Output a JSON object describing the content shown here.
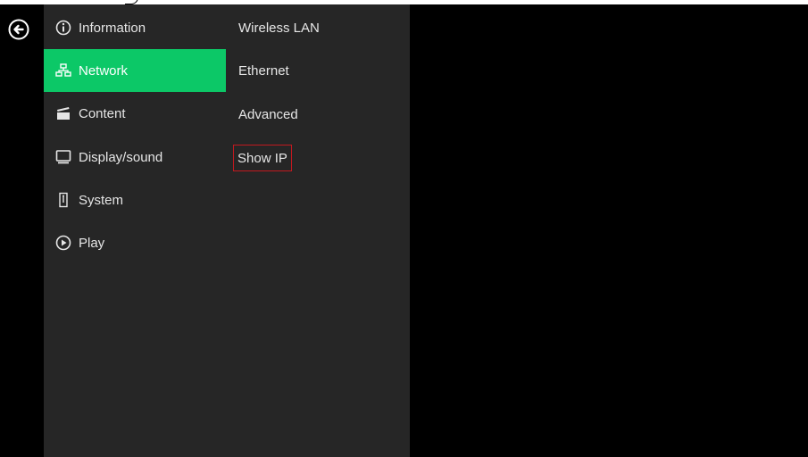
{
  "menu": {
    "items": [
      {
        "label": "Information",
        "icon": "info-icon"
      },
      {
        "label": "Network",
        "icon": "network-icon",
        "active": true
      },
      {
        "label": "Content",
        "icon": "clapperboard-icon"
      },
      {
        "label": "Display/sound",
        "icon": "monitor-icon"
      },
      {
        "label": "System",
        "icon": "system-icon"
      },
      {
        "label": "Play",
        "icon": "play-icon"
      }
    ]
  },
  "submenu": {
    "items": [
      {
        "label": "Wireless LAN"
      },
      {
        "label": "Ethernet"
      },
      {
        "label": "Advanced"
      },
      {
        "label": "Show IP",
        "highlighted": true
      }
    ]
  },
  "colors": {
    "active": "#0cc867",
    "panel": "#262626",
    "highlight_border": "#c2191f",
    "background": "#000000"
  }
}
